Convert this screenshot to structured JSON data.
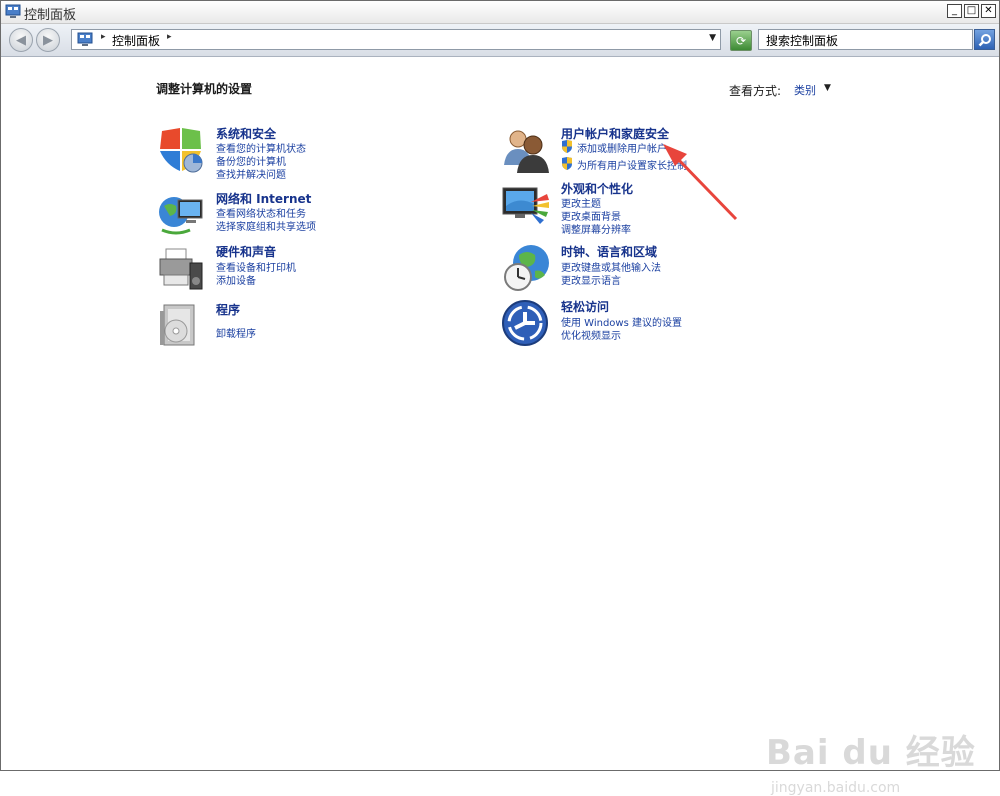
{
  "window": {
    "title": "控制面板"
  },
  "address": {
    "crumb": "控制面板"
  },
  "search": {
    "placeholder": "搜索控制面板"
  },
  "main": {
    "heading": "调整计算机的设置",
    "view_by_label": "查看方式:",
    "view_by_value": "类别"
  },
  "categories": [
    {
      "title": "系统和安全",
      "icon": "shield-icon",
      "links": [
        "查看您的计算机状态",
        "备份您的计算机",
        "查找并解决问题"
      ]
    },
    {
      "title": "网络和 Internet",
      "icon": "network-icon",
      "links": [
        "查看网络状态和任务",
        "选择家庭组和共享选项"
      ]
    },
    {
      "title": "硬件和声音",
      "icon": "printer-icon",
      "links": [
        "查看设备和打印机",
        "添加设备"
      ]
    },
    {
      "title": "程序",
      "icon": "programs-icon",
      "links": [
        "卸载程序"
      ]
    },
    {
      "title": "用户帐户和家庭安全",
      "icon": "users-icon",
      "links": [
        "添加或删除用户帐户",
        "为所有用户设置家长控制"
      ]
    },
    {
      "title": "外观和个性化",
      "icon": "monitor-icon",
      "links": [
        "更改主题",
        "更改桌面背景",
        "调整屏幕分辨率"
      ]
    },
    {
      "title": "时钟、语言和区域",
      "icon": "clock-globe-icon",
      "links": [
        "更改键盘或其他输入法",
        "更改显示语言"
      ]
    },
    {
      "title": "轻松访问",
      "icon": "ease-of-access-icon",
      "links": [
        "使用 Windows 建议的设置",
        "优化视频显示"
      ]
    }
  ],
  "watermark": {
    "brand": "Bai du 经验",
    "url": "jingyan.baidu.com"
  },
  "colors": {
    "link": "#1a3fa0",
    "category_title": "#17338c",
    "annotation_arrow": "#e8453c"
  }
}
